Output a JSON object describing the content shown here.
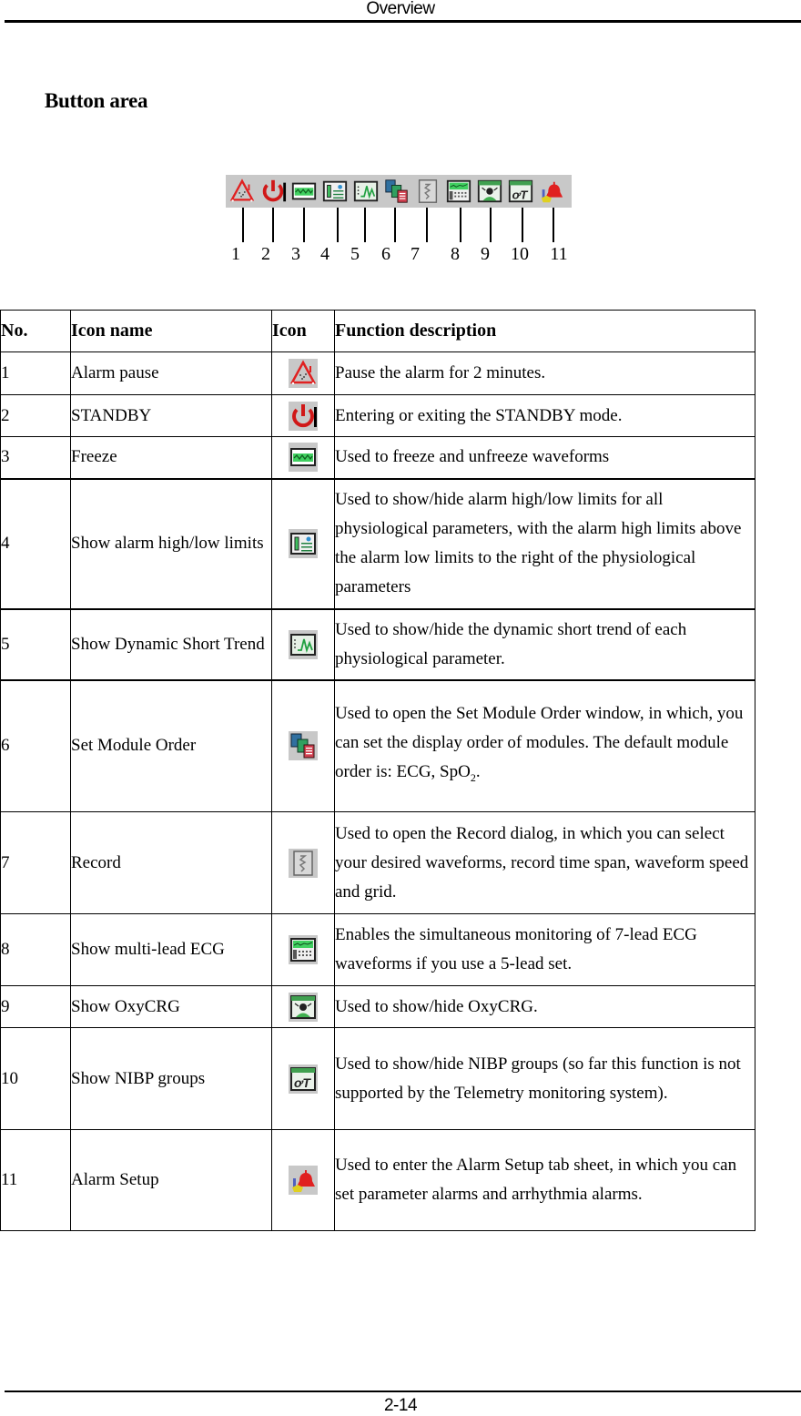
{
  "header": {
    "title": "Overview"
  },
  "section": {
    "title": "Button area"
  },
  "toolbar": {
    "buttons": [
      {
        "no": "1",
        "icon": "alarm-pause-icon"
      },
      {
        "no": "2",
        "icon": "standby-icon"
      },
      {
        "no": "3",
        "icon": "freeze-icon"
      },
      {
        "no": "4",
        "icon": "alarm-limits-icon"
      },
      {
        "no": "5",
        "icon": "short-trend-icon"
      },
      {
        "no": "6",
        "icon": "module-order-icon"
      },
      {
        "no": "7",
        "icon": "record-icon"
      },
      {
        "no": "8",
        "icon": "multi-lead-ecg-icon"
      },
      {
        "no": "9",
        "icon": "oxycrg-icon"
      },
      {
        "no": "10",
        "icon": "nibp-groups-icon"
      },
      {
        "no": "11",
        "icon": "alarm-setup-icon"
      }
    ]
  },
  "table": {
    "headers": {
      "no": "No.",
      "name": "Icon name",
      "icon": "Icon",
      "desc": "Function description"
    },
    "rows": [
      {
        "no": "1",
        "name": "Alarm pause",
        "icon": "alarm-pause-icon",
        "desc": "Pause the alarm for 2 minutes."
      },
      {
        "no": "2",
        "name": "STANDBY",
        "icon": "standby-icon",
        "desc": "Entering or exiting the STANDBY mode."
      },
      {
        "no": "3",
        "name": "Freeze",
        "icon": "freeze-icon",
        "desc": "Used to freeze and unfreeze waveforms"
      },
      {
        "no": "4",
        "name": "Show alarm high/low limits",
        "icon": "alarm-limits-icon",
        "desc": "Used to show/hide alarm high/low limits for all physiological parameters, with the alarm high limits above the alarm low limits to the right of the physiological parameters"
      },
      {
        "no": "5",
        "name": "Show Dynamic Short Trend",
        "icon": "short-trend-icon",
        "desc": "Used to show/hide the dynamic short trend of each physiological parameter."
      },
      {
        "no": "6",
        "name": "Set Module Order",
        "icon": "module-order-icon",
        "desc": "Used to open the Set Module Order window, in which, you can set the display order of modules. The default module order is: ECG, SpO",
        "desc_sub": "2",
        "desc_tail": "."
      },
      {
        "no": "7",
        "name": "Record",
        "icon": "record-icon",
        "desc": "Used to open the Record dialog, in which you can select your desired waveforms, record time span, waveform speed and grid."
      },
      {
        "no": "8",
        "name": "Show multi-lead ECG",
        "icon": "multi-lead-ecg-icon",
        "desc": "Enables the simultaneous monitoring of 7-lead ECG waveforms if you use a 5-lead set."
      },
      {
        "no": "9",
        "name": "Show OxyCRG",
        "icon": "oxycrg-icon",
        "desc": "Used to show/hide OxyCRG."
      },
      {
        "no": "10",
        "name": "Show NIBP groups",
        "icon": "nibp-groups-icon",
        "desc": "Used to show/hide NIBP groups (so far this function is not supported by the Telemetry monitoring system)."
      },
      {
        "no": "11",
        "name": "Alarm Setup",
        "icon": "alarm-setup-icon",
        "desc": "Used to enter the Alarm Setup tab sheet, in which you can set parameter alarms and arrhythmia alarms."
      }
    ]
  },
  "footer": {
    "page_number": "2-14"
  }
}
